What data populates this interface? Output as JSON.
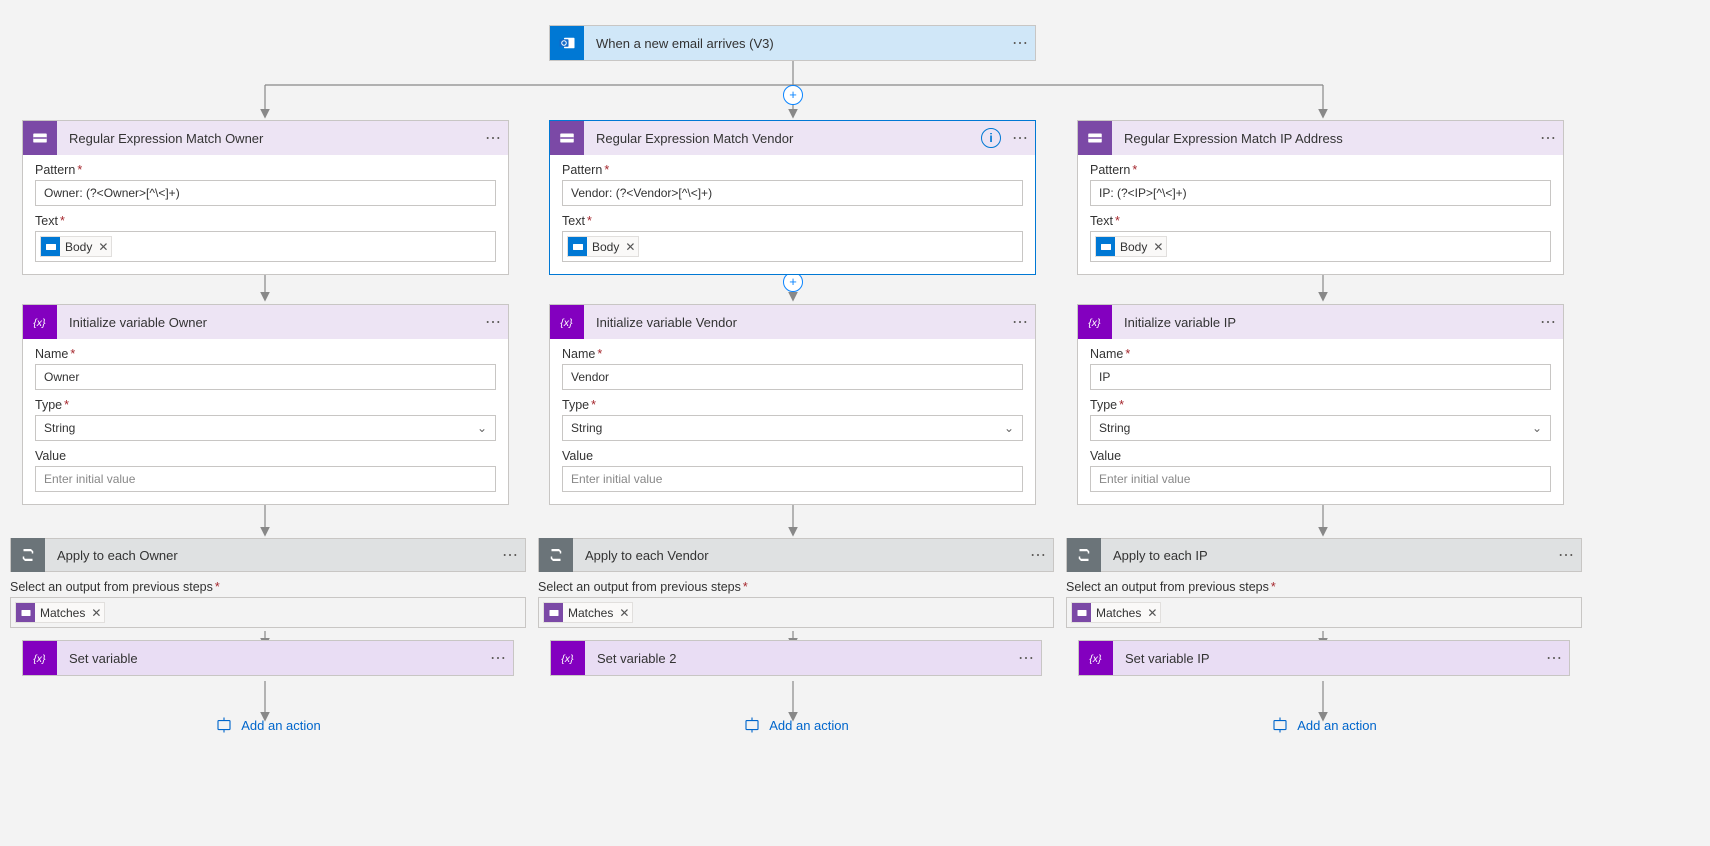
{
  "trigger": {
    "title": "When a new email arrives (V3)"
  },
  "common": {
    "menu": "⋯",
    "info": "i",
    "pattern_label": "Pattern",
    "text_label": "Text",
    "name_label": "Name",
    "type_label": "Type",
    "value_label": "Value",
    "string_type": "String",
    "value_placeholder": "Enter initial value",
    "body_token": "Body",
    "matches_token": "Matches",
    "loop_label": "Select an output from previous steps",
    "add_action": "Add an action"
  },
  "columns": [
    {
      "regex": {
        "title": "Regular Expression Match Owner",
        "pattern": "Owner: (?<Owner>[^\\<]+)"
      },
      "var": {
        "title": "Initialize variable Owner",
        "name": "Owner"
      },
      "loop": {
        "title": "Apply to each Owner",
        "set_title": "Set variable"
      },
      "selected": false
    },
    {
      "regex": {
        "title": "Regular Expression Match Vendor",
        "pattern": "Vendor: (?<Vendor>[^\\<]+)"
      },
      "var": {
        "title": "Initialize variable Vendor",
        "name": "Vendor"
      },
      "loop": {
        "title": "Apply to each Vendor",
        "set_title": "Set variable 2"
      },
      "selected": true
    },
    {
      "regex": {
        "title": "Regular Expression Match IP Address",
        "pattern": "IP: (?<IP>[^\\<]+)"
      },
      "var": {
        "title": "Initialize variable IP",
        "name": "IP"
      },
      "loop": {
        "title": "Apply to each IP",
        "set_title": "Set variable IP"
      },
      "selected": false
    }
  ]
}
